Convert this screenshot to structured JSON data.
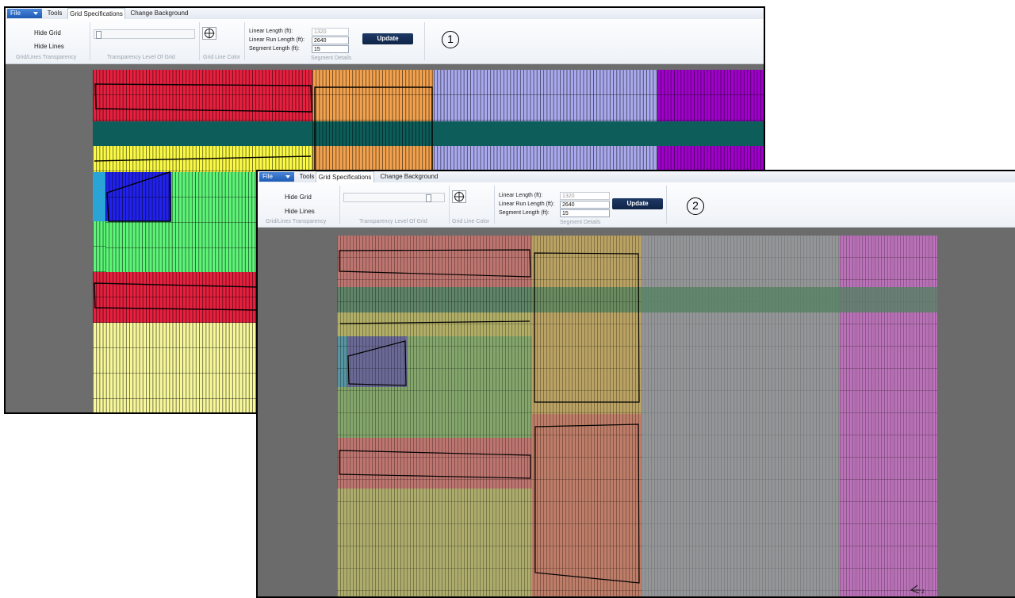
{
  "menu": {
    "file_label": "File",
    "tabs": [
      "Tools",
      "Grid Specifications",
      "Change Background"
    ]
  },
  "ribbon": {
    "hide_grid": "Hide Grid",
    "hide_lines": "Hide Lines",
    "group_transparency": "Grid/Lines Transparency",
    "group_level": "Transparency Level Of Grid",
    "group_color": "Grid Line Color",
    "linear_length_label": "Linear Length (ft):",
    "linear_length_value": "1320",
    "linear_run_label": "Linear Run Length (ft):",
    "linear_run_value": "2640",
    "segment_label": "Segment Length (ft):",
    "segment_value": "15",
    "update_label": "Update",
    "group_segment": "Segment Details",
    "crosshair_icon": "crosshair-icon"
  },
  "windows": [
    {
      "step_label": "1",
      "slider_level": 0.02
    },
    {
      "step_label": "2",
      "slider_level": 0.88
    }
  ],
  "colors": {
    "red": "#e8203f",
    "orange": "#f2a24e",
    "lavender": "#a9a9ee",
    "purple": "#a100cc",
    "teal": "#0d5e5a",
    "yellow": "#fafa46",
    "green": "#5df578",
    "blue": "#2222ee",
    "cyan": "#2aa4d6",
    "pale_yellow": "#f7f79b",
    "canvas_gray": "#6d6d6d"
  }
}
